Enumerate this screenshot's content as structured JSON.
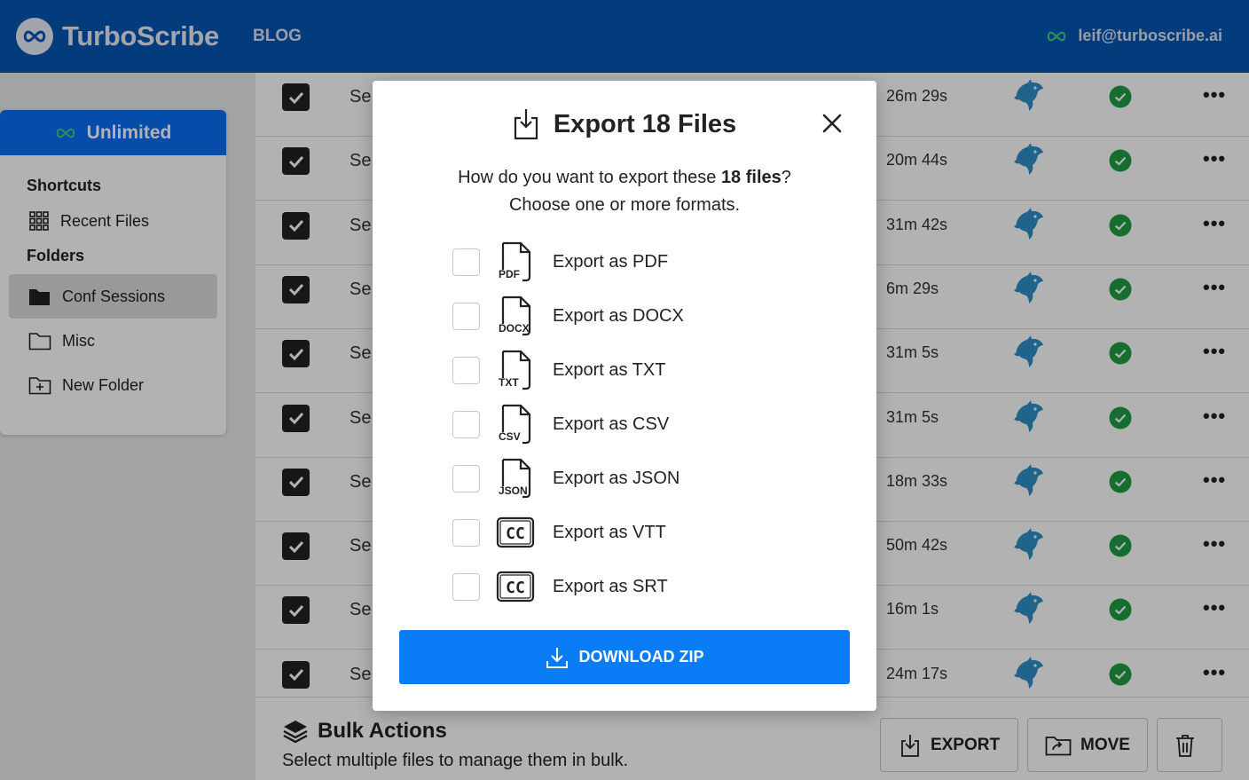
{
  "header": {
    "brand": "TurboScribe",
    "blog": "BLOG",
    "user_email": "leif@turboscribe.ai"
  },
  "sidebar": {
    "plan": "Unlimited",
    "shortcuts_heading": "Shortcuts",
    "recent_files": "Recent Files",
    "folders_heading": "Folders",
    "folders": [
      "Conf Sessions",
      "Misc",
      "New Folder"
    ]
  },
  "files": [
    {
      "name": "Se",
      "duration": "26m 29s"
    },
    {
      "name": "Se",
      "duration": "20m 44s"
    },
    {
      "name": "Se",
      "duration": "31m 42s"
    },
    {
      "name": "Se",
      "duration": "6m 29s"
    },
    {
      "name": "Se",
      "duration": "31m 5s"
    },
    {
      "name": "Se",
      "duration": "31m 5s"
    },
    {
      "name": "Se",
      "duration": "18m 33s"
    },
    {
      "name": "Se",
      "duration": "50m 42s"
    },
    {
      "name": "Se",
      "duration": "16m 1s"
    },
    {
      "name": "Se",
      "duration": "24m 17s"
    }
  ],
  "bulk": {
    "title": "Bulk Actions",
    "subtitle": "Select multiple files to manage them in bulk.",
    "export": "EXPORT",
    "move": "MOVE"
  },
  "modal": {
    "title": "Export 18 Files",
    "desc_pre": "How do you want to export these ",
    "desc_bold": "18 files",
    "desc_post": "?",
    "desc_line2": "Choose one or more formats.",
    "options": [
      {
        "label": "Export as PDF",
        "tag": "PDF",
        "icon": "file-icon"
      },
      {
        "label": "Export as DOCX",
        "tag": "DOCX",
        "icon": "file-icon"
      },
      {
        "label": "Export as TXT",
        "tag": "TXT",
        "icon": "file-icon"
      },
      {
        "label": "Export as CSV",
        "tag": "CSV",
        "icon": "file-icon"
      },
      {
        "label": "Export as JSON",
        "tag": "JSON",
        "icon": "file-icon"
      },
      {
        "label": "Export as VTT",
        "tag": "CC",
        "icon": "cc-icon"
      },
      {
        "label": "Export as SRT",
        "tag": "CC",
        "icon": "cc-icon"
      }
    ],
    "download": "DOWNLOAD ZIP"
  },
  "colors": {
    "header": "#0556b4",
    "primary": "#0a7cf5",
    "plan": "#0a6ef5",
    "ok": "#1f9d45",
    "dolphin": "#2e8fc7"
  }
}
